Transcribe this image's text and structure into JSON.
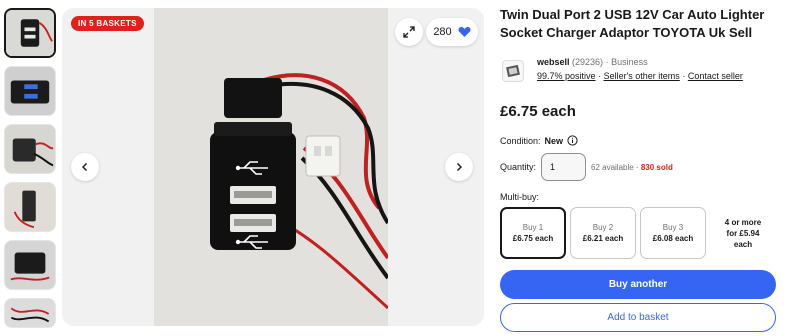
{
  "gallery": {
    "badge": "IN 5 BASKETS",
    "watch_count": "280",
    "thumbnails": [
      "thumb-1",
      "thumb-2",
      "thumb-3",
      "thumb-4",
      "thumb-5",
      "thumb-6"
    ]
  },
  "listing": {
    "title": "Twin Dual Port 2 USB 12V Car Auto Lighter Socket Charger Adaptor TOYOTA Uk Sell"
  },
  "seller": {
    "name": "websell",
    "feedback_count": "(29236)",
    "type": "· Business",
    "positive": "99.7% positive",
    "other_items": "Seller's other items",
    "contact": "Contact seller"
  },
  "price": "£6.75 each",
  "condition": {
    "label": "Condition:",
    "value": "New"
  },
  "quantity": {
    "label": "Quantity:",
    "value": "1",
    "available": "62 available ·",
    "sold": "830 sold"
  },
  "multibuy": {
    "label": "Multi-buy:",
    "options": [
      {
        "qty": "Buy 1",
        "price": "£6.75 each"
      },
      {
        "qty": "Buy 2",
        "price": "£6.21 each"
      },
      {
        "qty": "Buy 3",
        "price": "£6.08 each"
      },
      {
        "qty": "4 or more",
        "price": "for £5.94 each"
      }
    ]
  },
  "actions": {
    "buy": "Buy another",
    "add": "Add to basket"
  },
  "colors": {
    "accent": "#3665f3",
    "badge": "#e0201a",
    "heart": "#3665f3"
  }
}
